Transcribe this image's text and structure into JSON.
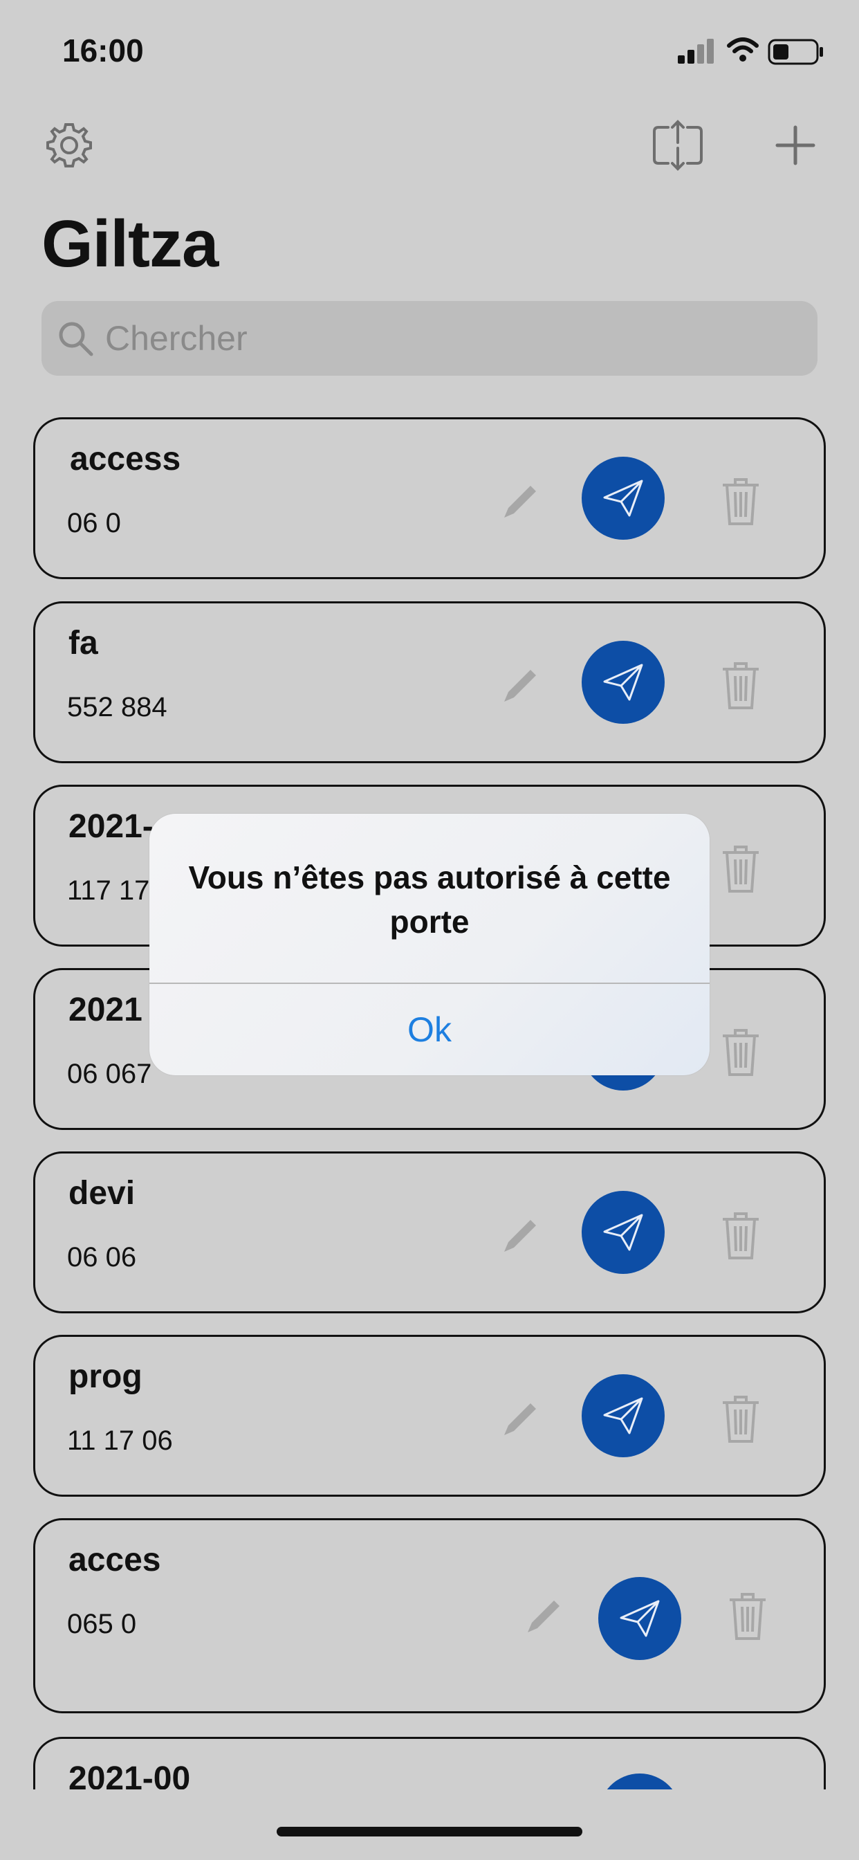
{
  "status_bar": {
    "time": "16:00"
  },
  "header": {
    "title": "Giltza"
  },
  "search": {
    "placeholder": "Chercher"
  },
  "items": [
    {
      "title": "access",
      "subtitle": "06    0"
    },
    {
      "title": "fa",
      "subtitle": "552 884"
    },
    {
      "title": "2021-",
      "subtitle": "117   17"
    },
    {
      "title": "2021",
      "subtitle": "06    067"
    },
    {
      "title": "devi",
      "subtitle": "06    06"
    },
    {
      "title": "prog",
      "subtitle": "11    17 06"
    },
    {
      "title": "acces",
      "subtitle": "065 0"
    },
    {
      "title": "2021-00",
      "subtitle": ""
    }
  ],
  "alert": {
    "message": "Vous n’êtes pas autorisé à cette porte",
    "ok_label": "Ok"
  },
  "colors": {
    "send_button": "#0d4ea6",
    "alert_ok": "#1d7fe0",
    "background": "#cfcfcf"
  }
}
